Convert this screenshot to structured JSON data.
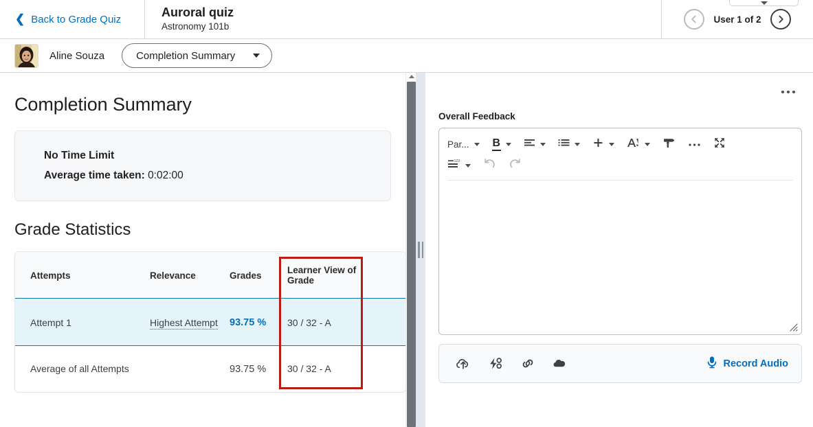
{
  "header": {
    "back_label": "Back to Grade Quiz",
    "quiz_title": "Auroral quiz",
    "course_name": "Astronomy 101b",
    "user_count": "User 1 of 2"
  },
  "subheader": {
    "user_name": "Aline Souza",
    "view_selector": "Completion Summary"
  },
  "left": {
    "page_title": "Completion Summary",
    "time_limit": "No Time Limit",
    "avg_time_label": "Average time taken:",
    "avg_time_value": "0:02:00",
    "grade_stats_title": "Grade Statistics",
    "table": {
      "columns": [
        "Attempts",
        "Relevance",
        "Grades",
        "Learner View of Grade",
        ""
      ],
      "rows": [
        {
          "attempts": "Attempt 1",
          "relevance": "Highest Attempt",
          "grades": "93.75 %",
          "learner_view": "30 / 32 - A",
          "highlighted": true
        },
        {
          "attempts": "Average of all Attempts",
          "relevance": "",
          "grades": "93.75 %",
          "learner_view": "30 / 32 - A",
          "highlighted": false
        }
      ]
    }
  },
  "right": {
    "feedback_label": "Overall Feedback",
    "editor_value": "",
    "editor_placeholder": "",
    "toolbar_row1": [
      {
        "name": "paragraph-format-dropdown",
        "label": "Par...",
        "type": "text-caret"
      },
      {
        "name": "bold-dropdown",
        "label": "B",
        "type": "bold-caret"
      },
      {
        "name": "align-dropdown",
        "label": "",
        "type": "align-caret"
      },
      {
        "name": "list-dropdown",
        "label": "",
        "type": "list-caret"
      },
      {
        "name": "insert-dropdown",
        "label": "",
        "type": "plus-caret"
      },
      {
        "name": "font-style-dropdown",
        "label": "",
        "type": "font-caret"
      },
      {
        "name": "format-painter-button",
        "label": "",
        "type": "painter"
      },
      {
        "name": "more-options-button",
        "label": "",
        "type": "ellipsis"
      },
      {
        "name": "fullscreen-button",
        "label": "",
        "type": "expand"
      }
    ],
    "toolbar_row2": [
      {
        "name": "line-spacing-dropdown",
        "label": "",
        "type": "spacing-caret"
      },
      {
        "name": "undo-button",
        "label": "",
        "type": "undo"
      },
      {
        "name": "redo-button",
        "label": "",
        "type": "redo"
      }
    ],
    "attachments": [
      {
        "name": "upload-file-icon",
        "title": "Upload"
      },
      {
        "name": "quicklink-icon",
        "title": "Insert Quicklink"
      },
      {
        "name": "link-icon",
        "title": "Insert Link"
      },
      {
        "name": "onedrive-cloud-icon",
        "title": "OneDrive"
      }
    ],
    "record_audio_label": "Record Audio"
  },
  "colors": {
    "link_blue": "#006fbf",
    "annotation_red": "#bb1b17",
    "row_highlight_bg": "#e5f4fb",
    "row_highlight_border": "#1b74a8",
    "panel_gray": "#f7f8fa",
    "splitter_bg": "#e2e7ef",
    "scrollbar_thumb": "#6e7378"
  }
}
